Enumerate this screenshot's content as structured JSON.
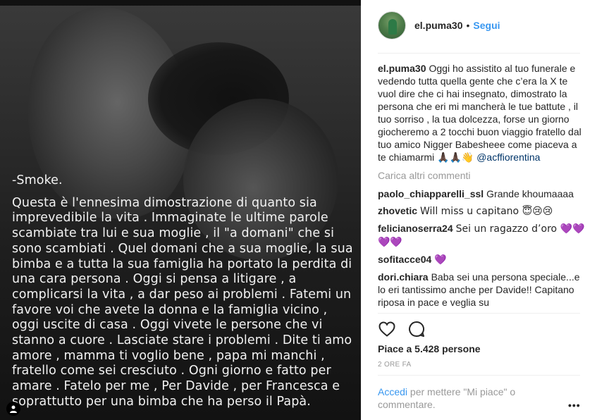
{
  "overlay": {
    "title": "-Smoke.",
    "body": "Questa è l'ennesima dimostrazione di quanto sia imprevedibile la vita . Immaginate le ultime parole scambiate tra lui e sua moglie , il \"a domani\" che si sono scambiati . Quel domani che a sua moglie, la sua bimba e a tutta la sua famiglia ha portato la perdita di una cara persona . Oggi si pensa a litigare , a complicarsi la vita , a dar peso ai problemi . Fatemi un favore voi che avete la donna e la famiglia vicino , oggi uscite di casa . Oggi vivete le persone che vi stanno a cuore . Lasciate stare i problemi . Dite ti amo amore , mamma ti voglio bene , papa mi manchi , fratello come sei cresciuto . Ogni giorno e fatto per amare . Fatelo per me , Per Davide , per Francesca e soprattutto per una bimba che ha perso il Papà."
  },
  "header": {
    "username": "el.puma30",
    "dot": "•",
    "follow_label": "Segui"
  },
  "caption": {
    "username": "el.puma30",
    "text": "Oggi ho assistito al tuo funerale e vedendo tutta quella gente che c’era la X te vuol dire che ci hai insegnato, dimostrato la persona che eri mi mancherà le tue battute , il tuo sorriso , la tua dolcezza, forse un giorno giocheremo a 2 tocchi buon viaggio fratello dal tuo amico Nigger Babesheee come piaceva a te chiamarmi 🙏🏿🙏🏿👋",
    "mention": "@acffiorentina"
  },
  "load_more": "Carica altri commenti",
  "comments": [
    {
      "username": "paolo_chiapparelli_ssl",
      "text": "Grande khoumaaaa"
    },
    {
      "username": "zhovetic",
      "text": "Will miss u capitano 😇😢😢"
    },
    {
      "username": "felicianoserra24",
      "text": "Sei un ragazzo d’oro 💜💜💜💜"
    },
    {
      "username": "sofitacce04",
      "text": "💜"
    },
    {
      "username": "dori.chiara",
      "text": "Baba sei una persona speciale...e lo eri tantissimo anche per Davide!! Capitano riposa in pace e veglia su"
    }
  ],
  "likes_text": "Piace a 5.428 persone",
  "time_text": "2 ORE FA",
  "add_comment": {
    "login_label": "Accedi",
    "rest": "per mettere \"Mi piace\" o commentare."
  },
  "more_label": "•••",
  "icons": {
    "heart": "heart-icon",
    "comment": "comment-icon",
    "tag": "user-tag-icon"
  }
}
